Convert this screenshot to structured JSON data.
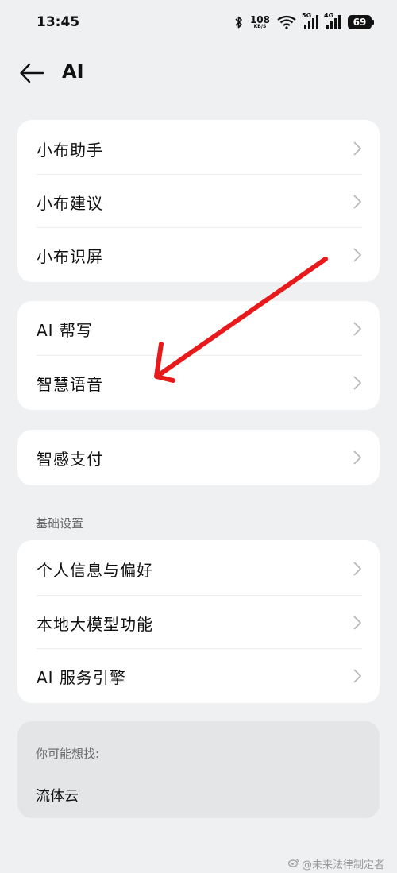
{
  "status_bar": {
    "time": "13:45",
    "net_speed_value": "108",
    "net_speed_unit": "KB/S",
    "sim1_label": "5G",
    "sim2_label": "4G",
    "battery": "69"
  },
  "header": {
    "title": "AI"
  },
  "group1": {
    "items": [
      {
        "label": "小布助手"
      },
      {
        "label": "小布建议"
      },
      {
        "label": "小布识屏"
      }
    ]
  },
  "group2": {
    "items": [
      {
        "label": "AI 帮写"
      },
      {
        "label": "智慧语音"
      }
    ]
  },
  "group3": {
    "items": [
      {
        "label": "智感支付"
      }
    ]
  },
  "basic_settings": {
    "section_title": "基础设置",
    "items": [
      {
        "label": "个人信息与偏好"
      },
      {
        "label": "本地大模型功能"
      },
      {
        "label": "AI 服务引擎"
      }
    ]
  },
  "suggestions": {
    "hint": "你可能想找:",
    "items": [
      {
        "label": "流体云"
      }
    ]
  },
  "watermark": "@未来法律制定者",
  "colors": {
    "background": "#eef0f2",
    "card": "#ffffff",
    "annotation_arrow": "#e8191b"
  }
}
